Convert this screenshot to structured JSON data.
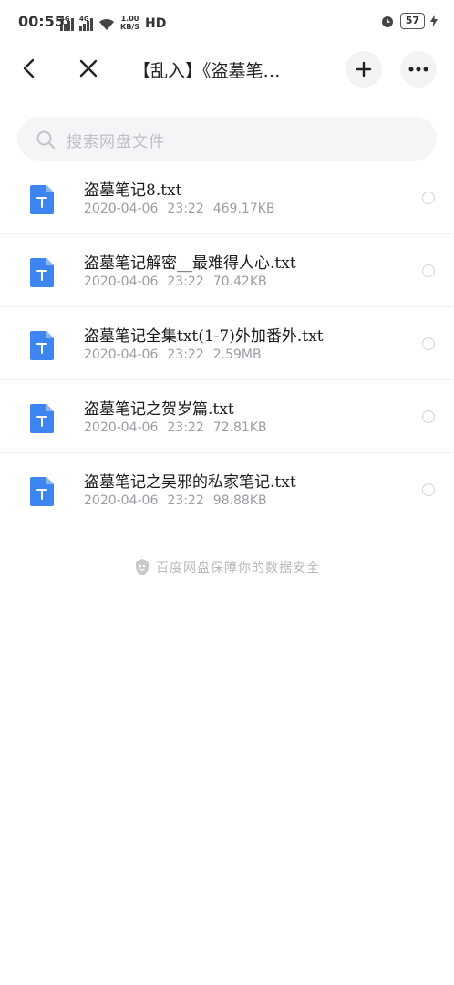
{
  "status_bar": {
    "time": "00:55",
    "net1": "4G",
    "net2": "4G",
    "speed_value": "1.00",
    "speed_unit": "KB/S",
    "hd": "HD",
    "battery": "57"
  },
  "header": {
    "title": "【乱入】《盗墓笔…"
  },
  "search": {
    "placeholder": "搜索网盘文件"
  },
  "files": [
    {
      "name": "盗墓笔记8.txt",
      "date": "2020-04-06",
      "time": "23:22",
      "size": "469.17KB"
    },
    {
      "name": "盗墓笔记解密__最难得人心.txt",
      "date": "2020-04-06",
      "time": "23:22",
      "size": "70.42KB"
    },
    {
      "name": "盗墓笔记全集txt(1-7)外加番外.txt",
      "date": "2020-04-06",
      "time": "23:22",
      "size": "2.59MB"
    },
    {
      "name": "盗墓笔记之贺岁篇.txt",
      "date": "2020-04-06",
      "time": "23:22",
      "size": "72.81KB"
    },
    {
      "name": "盗墓笔记之吴邪的私家笔记.txt",
      "date": "2020-04-06",
      "time": "23:22",
      "size": "98.88KB"
    }
  ],
  "footer": {
    "text": "百度网盘保障你的数据安全"
  },
  "colors": {
    "accent": "#3b82f6",
    "file_icon": "#3d85f0"
  }
}
